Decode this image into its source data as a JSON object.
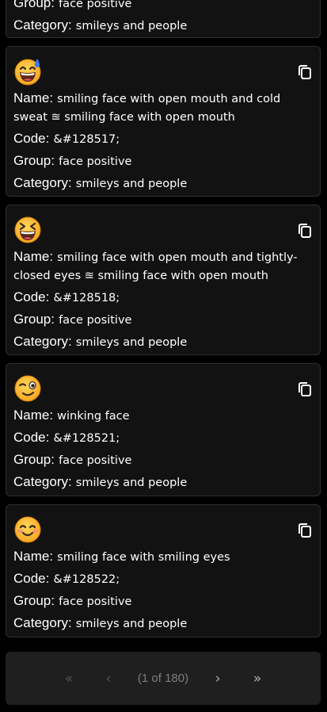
{
  "labels": {
    "name": "Name:",
    "code": "Code:",
    "group": "Group:",
    "category": "Category:"
  },
  "partial_card": {
    "group": "face positive",
    "category": "smileys and people"
  },
  "cards": [
    {
      "icon": "grinning-sweat-icon",
      "name": "smiling face with open mouth and cold sweat ≊ smiling face with open mouth",
      "code": "&#128517;",
      "group": "face positive",
      "category": "smileys and people"
    },
    {
      "icon": "squinting-laughing-icon",
      "name": "smiling face with open mouth and tightly-closed eyes ≊ smiling face with open mouth",
      "code": "&#128518;",
      "group": "face positive",
      "category": "smileys and people"
    },
    {
      "icon": "winking-face-icon",
      "name": "winking face",
      "code": "&#128521;",
      "group": "face positive",
      "category": "smileys and people"
    },
    {
      "icon": "smiling-eyes-icon",
      "name": "smiling face with smiling eyes",
      "code": "&#128522;",
      "group": "face positive",
      "category": "smileys and people"
    }
  ],
  "pagination": {
    "first": "«",
    "prev": "‹",
    "info": "(1 of 180)",
    "next": "›",
    "last": "»"
  },
  "colors": {
    "card_bg": "#121212",
    "card_border": "#2e2e2e",
    "pager_bg": "#1f1f1f",
    "emoji_yellow": "#ffc83d",
    "emoji_outline": "#d67d00"
  }
}
